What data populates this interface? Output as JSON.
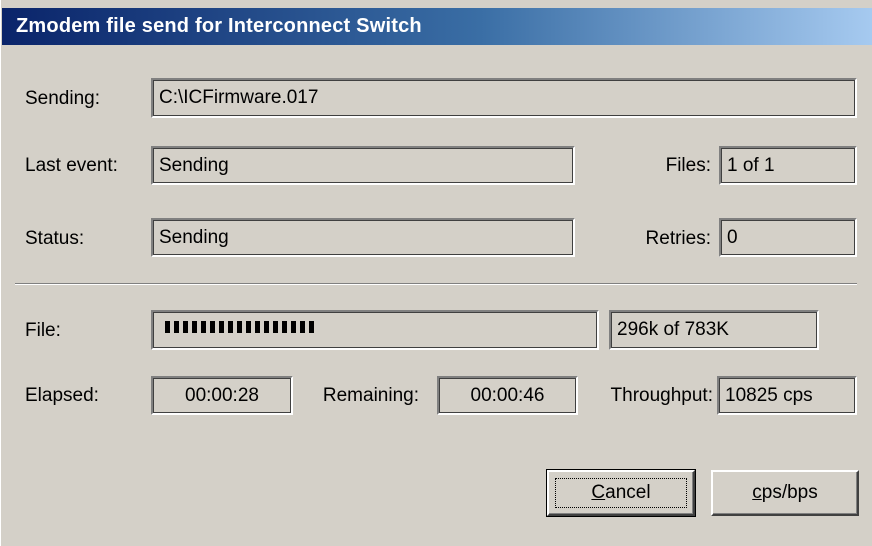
{
  "window": {
    "title": "Zmodem file send for Interconnect Switch"
  },
  "sending": {
    "label": "Sending:",
    "value": "C:\\ICFirmware.017"
  },
  "last_event": {
    "label": "Last event:",
    "value": "Sending"
  },
  "files": {
    "label": "Files:",
    "value": "1 of 1"
  },
  "status": {
    "label": "Status:",
    "value": "Sending"
  },
  "retries": {
    "label": "Retries:",
    "value": "0"
  },
  "file": {
    "label": "File:",
    "progress_fraction": 0.378,
    "progress_text": "296k of 783K"
  },
  "elapsed": {
    "label": "Elapsed:",
    "value": "00:00:28"
  },
  "remaining": {
    "label": "Remaining:",
    "value": "00:00:46"
  },
  "throughput": {
    "label": "Throughput:",
    "value": "10825 cps"
  },
  "buttons": {
    "cancel": "Cancel",
    "cps_bps": "cps/bps"
  },
  "colors": {
    "face": "#d4d0c8",
    "title_start": "#0a246a",
    "title_end": "#a6caf0"
  }
}
